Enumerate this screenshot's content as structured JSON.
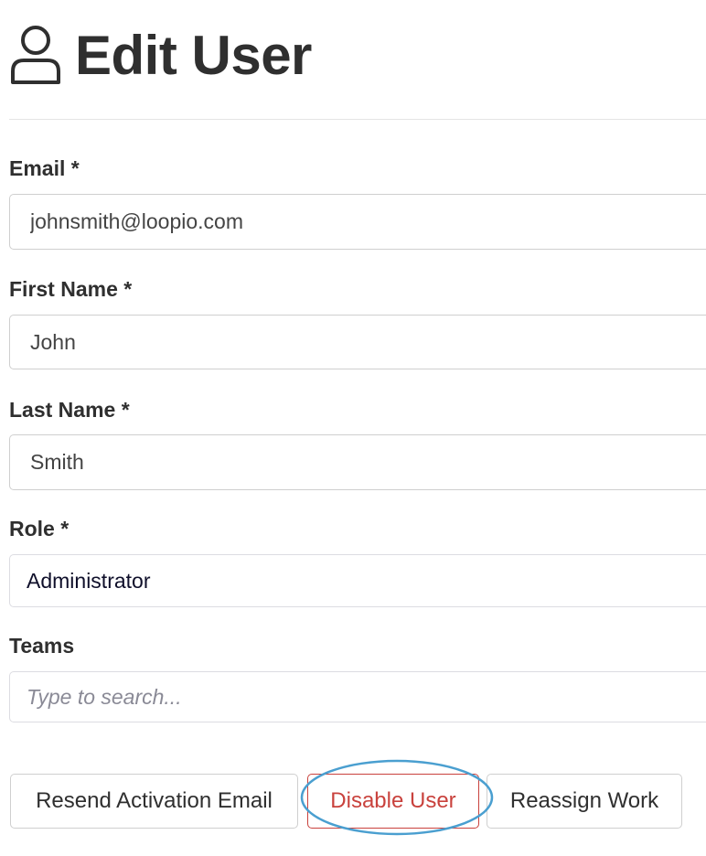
{
  "page": {
    "title": "Edit User",
    "icon": "user-icon"
  },
  "form": {
    "email": {
      "label": "Email *",
      "value": "johnsmith@loopio.com"
    },
    "first_name": {
      "label": "First Name *",
      "value": "John"
    },
    "last_name": {
      "label": "Last Name *",
      "value": "Smith"
    },
    "role": {
      "label": "Role *",
      "value": "Administrator"
    },
    "teams": {
      "label": "Teams",
      "placeholder": "Type to search..."
    }
  },
  "actions": {
    "resend_label": "Resend Activation Email",
    "disable_label": "Disable User",
    "reassign_label": "Reassign Work"
  },
  "colors": {
    "danger": "#c9423d",
    "highlight": "#4a9fd0",
    "border": "#cfcfcf"
  }
}
